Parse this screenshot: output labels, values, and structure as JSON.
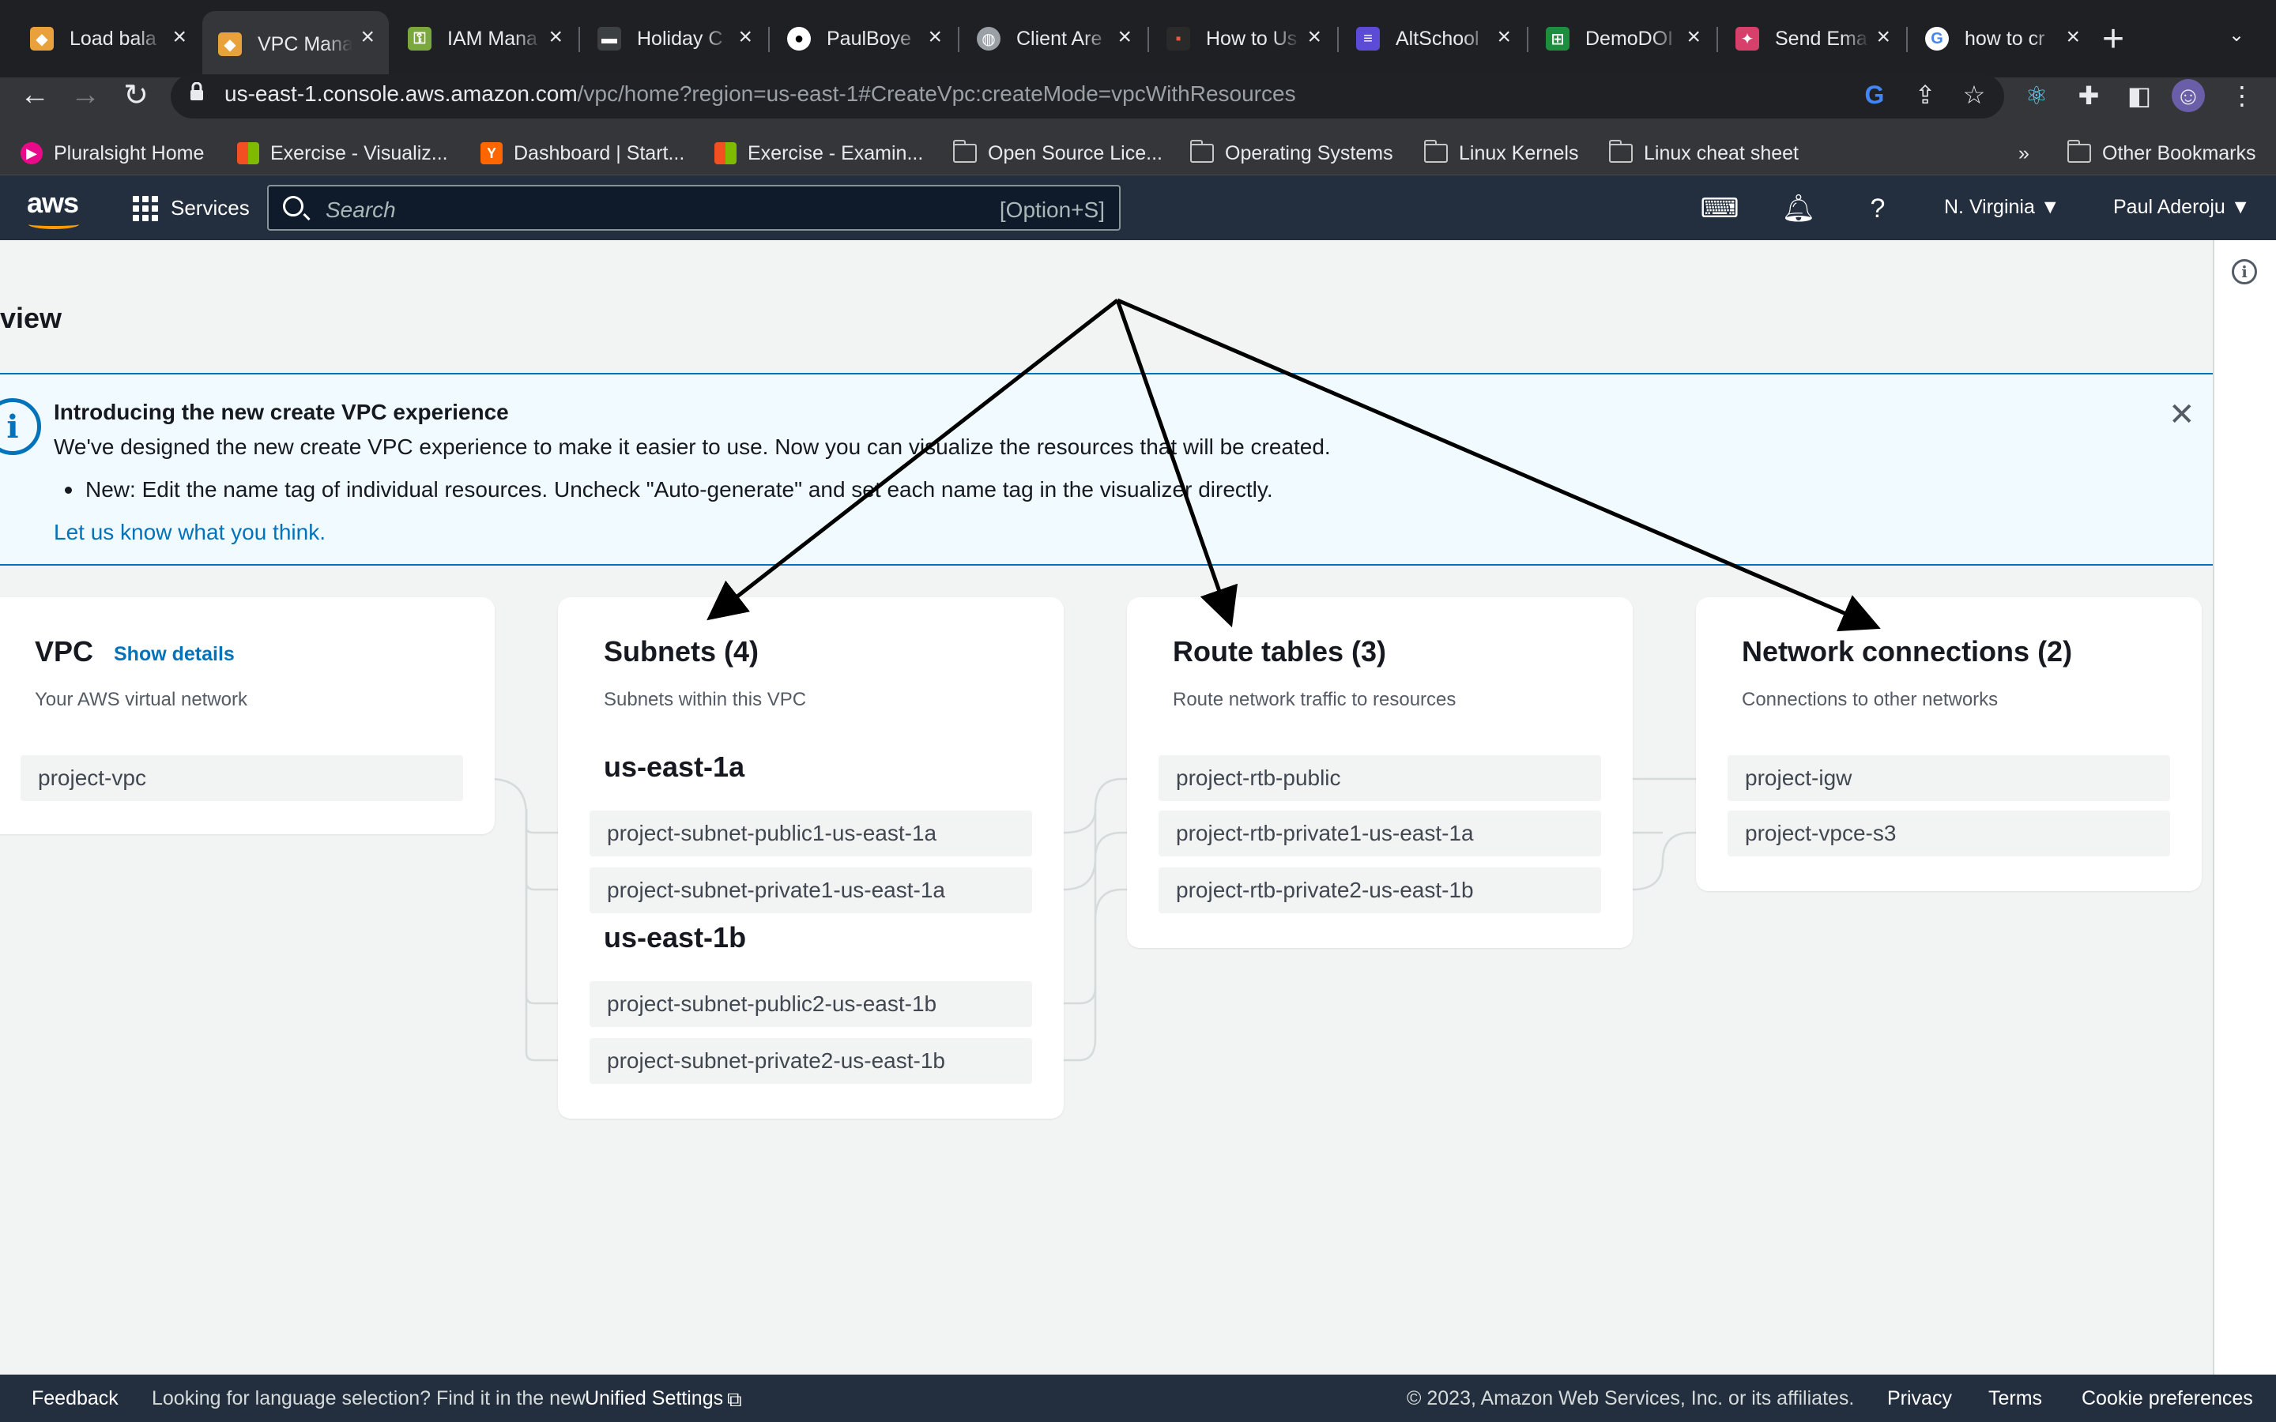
{
  "tabs": [
    {
      "title": "Load bala",
      "icon": "aws-box-icon",
      "color": "#e9a23b"
    },
    {
      "title": "VPC Mana",
      "icon": "aws-box-icon",
      "color": "#e9a23b"
    },
    {
      "title": "IAM Mana",
      "icon": "key-icon",
      "color": "#7aa83e"
    },
    {
      "title": "Holiday C",
      "icon": "site-icon",
      "color": "#3c4043"
    },
    {
      "title": "PaulBoye",
      "icon": "github-icon",
      "color": "#ffffff"
    },
    {
      "title": "Client Are",
      "icon": "globe-icon",
      "color": "#9aa0a6"
    },
    {
      "title": "How to Us",
      "icon": "site-icon",
      "color": "#e9573f"
    },
    {
      "title": "AltSchool",
      "icon": "list-icon",
      "color": "#5b4bd6"
    },
    {
      "title": "DemoDOI",
      "icon": "sheets-icon",
      "color": "#1e8e3e"
    },
    {
      "title": "Send Ema",
      "icon": "sendgrid-icon",
      "color": "#d6406b"
    },
    {
      "title": "how to cr",
      "icon": "google-icon",
      "color": "#ffffff"
    }
  ],
  "address": {
    "host": "us-east-1.console.aws.amazon.com",
    "path": "/vpc/home?region=us-east-1#CreateVpc:createMode=vpcWithResources"
  },
  "bookmarks": [
    {
      "label": "Pluralsight Home",
      "icon": "pluralsight-icon"
    },
    {
      "label": "Exercise - Visualiz...",
      "icon": "microsoft-icon"
    },
    {
      "label": "Dashboard | Start...",
      "icon": "ycombinator-icon"
    },
    {
      "label": "Exercise - Examin...",
      "icon": "microsoft-icon"
    },
    {
      "label": "Open Source Lice...",
      "icon": "folder-icon"
    },
    {
      "label": "Operating Systems",
      "icon": "folder-icon"
    },
    {
      "label": "Linux Kernels",
      "icon": "folder-icon"
    },
    {
      "label": "Linux cheat sheet",
      "icon": "folder-icon"
    }
  ],
  "bookmarks_more": "»",
  "bookmarks_other": "Other Bookmarks",
  "aws": {
    "logo": "aws",
    "services": "Services",
    "search_placeholder": "Search",
    "search_shortcut": "[Option+S]",
    "region": "N. Virginia ▼",
    "user": "Paul Aderoju ▼"
  },
  "page": {
    "title": "view",
    "flash": {
      "heading": "Introducing the new create VPC experience",
      "body": "We've designed the new create VPC experience to make it easier to use. Now you can visualize the resources that will be created.",
      "bullet": "New: Edit the name tag of individual resources. Uncheck \"Auto-generate\" and set each name tag in the visualizer directly.",
      "link": "Let us know what you think."
    },
    "vpc": {
      "title": "VPC",
      "show_details": "Show details",
      "subtitle": "Your AWS virtual network",
      "items": [
        "project-vpc"
      ]
    },
    "subnets": {
      "title": "Subnets (4)",
      "subtitle": "Subnets within this VPC",
      "az1": "us-east-1a",
      "az1_items": [
        "project-subnet-public1-us-east-1a",
        "project-subnet-private1-us-east-1a"
      ],
      "az2": "us-east-1b",
      "az2_items": [
        "project-subnet-public2-us-east-1b",
        "project-subnet-private2-us-east-1b"
      ]
    },
    "routes": {
      "title": "Route tables (3)",
      "subtitle": "Route network traffic to resources",
      "items": [
        "project-rtb-public",
        "project-rtb-private1-us-east-1a",
        "project-rtb-private2-us-east-1b"
      ]
    },
    "network": {
      "title": "Network connections (2)",
      "subtitle": "Connections to other networks",
      "items": [
        "project-igw",
        "project-vpce-s3"
      ]
    }
  },
  "footer": {
    "feedback": "Feedback",
    "lang": "Looking for language selection? Find it in the new",
    "unified": "Unified Settings",
    "copyright": "© 2023, Amazon Web Services, Inc. or its affiliates.",
    "privacy": "Privacy",
    "terms": "Terms",
    "cookies": "Cookie preferences"
  }
}
